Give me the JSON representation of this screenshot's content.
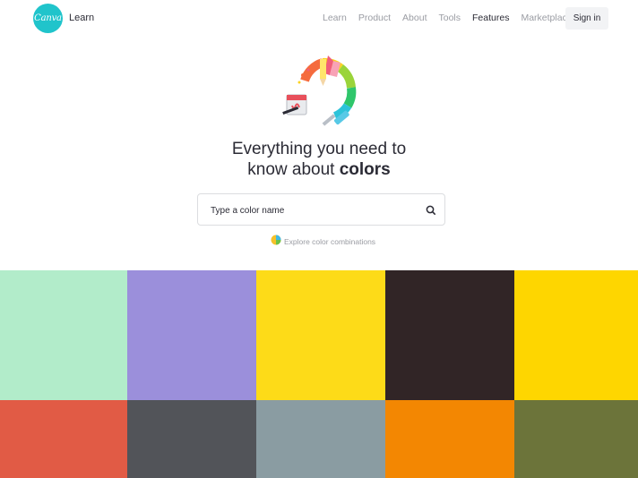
{
  "header": {
    "logo_text": "Canva",
    "brand_sub": "Learn",
    "nav": [
      "Learn",
      "Product",
      "About",
      "Tools",
      "Features",
      "Marketplace"
    ],
    "active_nav": "Features",
    "signin_label": "Sign in"
  },
  "hero": {
    "headline_line1": "Everything you need to",
    "headline_line2_prefix": "know about ",
    "headline_line2_bold": "colors",
    "icon": "paint-tools-color-wheel-icon"
  },
  "search": {
    "placeholder": "Type a color name",
    "icon": "search-icon"
  },
  "explore": {
    "label": "Explore color combinations",
    "icon": "color-combination-icon"
  },
  "swatches": [
    {
      "color": "#b2ecca"
    },
    {
      "color": "#9b8fdb"
    },
    {
      "color": "#fddb18"
    },
    {
      "color": "#312526"
    },
    {
      "color": "#fed600"
    },
    {
      "color": "#e15b45"
    },
    {
      "color": "#525459"
    },
    {
      "color": "#8a9ca2"
    },
    {
      "color": "#f38702"
    },
    {
      "color": "#6c743a"
    }
  ]
}
